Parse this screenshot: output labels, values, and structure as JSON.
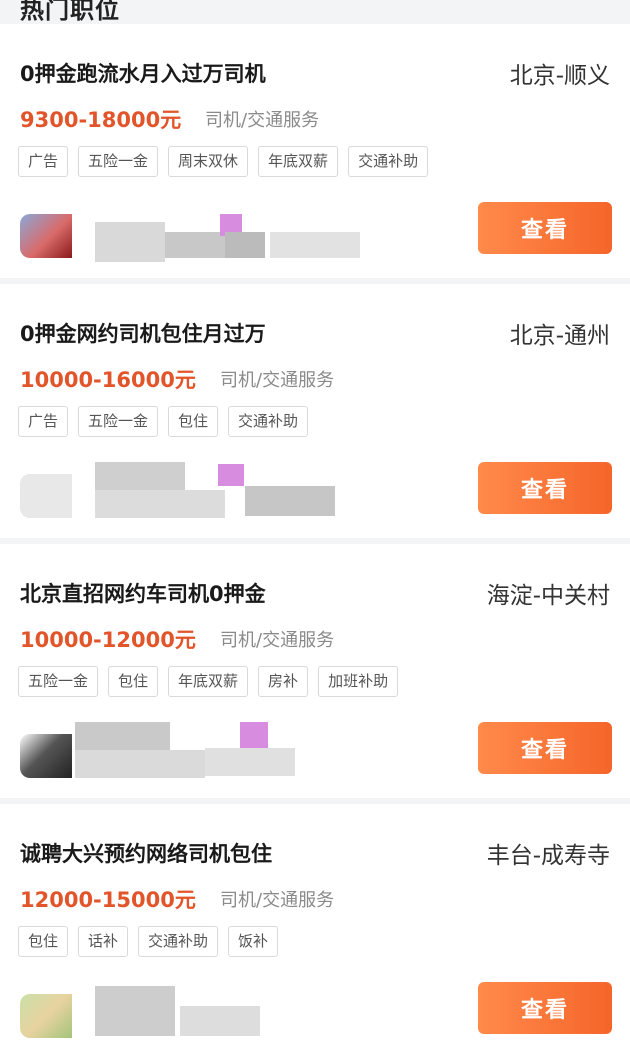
{
  "section": {
    "title": "热门职位"
  },
  "button_label": "查看",
  "colors": {
    "salary": "#e2552a",
    "button": "#f5652a",
    "card_bg": "#ffffff",
    "page_bg": "#f3f4f6"
  },
  "jobs": [
    {
      "title": "0押金跑流水月入过万司机",
      "location": "北京-顺义",
      "salary": "9300-18000元",
      "category": "司机/交通服务",
      "tags": [
        "广告",
        "五险一金",
        "周末双休",
        "年底双薪",
        "交通补助"
      ]
    },
    {
      "title": "0押金网约司机包住月过万",
      "location": "北京-通州",
      "salary": "10000-16000元",
      "category": "司机/交通服务",
      "tags": [
        "广告",
        "五险一金",
        "包住",
        "交通补助"
      ]
    },
    {
      "title": "北京直招网约车司机0押金",
      "location": "海淀-中关村",
      "salary": "10000-12000元",
      "category": "司机/交通服务",
      "tags": [
        "五险一金",
        "包住",
        "年底双薪",
        "房补",
        "加班补助"
      ]
    },
    {
      "title": "诚聘大兴预约网络司机包住",
      "location": "丰台-成寿寺",
      "salary": "12000-15000元",
      "category": "司机/交通服务",
      "tags": [
        "包住",
        "话补",
        "交通补助",
        "饭补"
      ]
    }
  ]
}
